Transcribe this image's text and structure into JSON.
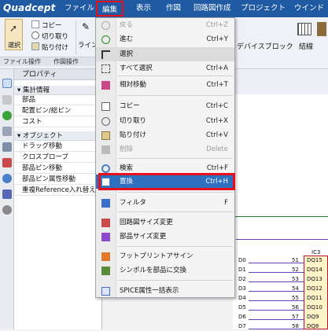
{
  "app": {
    "logo": "Quadcept"
  },
  "menubar": {
    "items": [
      "ファイル",
      "編集",
      "表示",
      "作図",
      "回路図作成",
      "プロジェクト",
      "ウインド"
    ]
  },
  "ribbon": {
    "select_label": "選択",
    "copy_label": "コピー",
    "cut_label": "切り取り",
    "paste_label": "貼り付け",
    "line_label": "ライン",
    "device_block_label": "デバイスブロック",
    "wire_label": "結線",
    "groups": [
      "ファイル操作",
      "作図操作"
    ]
  },
  "properties": {
    "title": "プロパティ",
    "categories": [
      {
        "label": "集計情報",
        "items": [
          "部品",
          "配置ピン/総ピン",
          "コスト"
        ]
      },
      {
        "label": "オブジェクト",
        "items": [
          "ドラッグ移動",
          "クロスプローブ",
          "部品ピン移動",
          "部品ピン属性移動",
          "重複Reference入れ替え"
        ]
      }
    ]
  },
  "schematic": {
    "ic_label": "IC3",
    "pins": [
      {
        "net": "D0",
        "num": "51",
        "name": "DQ15"
      },
      {
        "net": "D1",
        "num": "52",
        "name": "DQ14"
      },
      {
        "net": "D2",
        "num": "53",
        "name": "DQ13"
      },
      {
        "net": "D3",
        "num": "54",
        "name": "DQ12"
      },
      {
        "net": "D4",
        "num": "55",
        "name": "DQ11"
      },
      {
        "net": "D5",
        "num": "56",
        "name": "DQ10"
      },
      {
        "net": "D6",
        "num": "57",
        "name": "DQ9"
      },
      {
        "net": "D7",
        "num": "58",
        "name": "DQ8"
      }
    ]
  },
  "edit_menu": {
    "items": [
      {
        "label": "戻る",
        "shortcut": "Ctrl+Z",
        "icon": "undo-icon",
        "state": "disabled"
      },
      {
        "label": "進む",
        "shortcut": "Ctrl+Y",
        "icon": "redo-icon",
        "state": "normal"
      },
      {
        "label": "選択",
        "shortcut": "",
        "icon": "pointer-icon",
        "state": "selected"
      },
      {
        "label": "すべて選択",
        "shortcut": "Ctrl+A",
        "icon": "select-all-icon",
        "state": "normal"
      },
      {
        "label": "相対移動",
        "shortcut": "Ctrl+T",
        "icon": "relative-move-icon",
        "state": "normal"
      },
      {
        "label": "コピー",
        "shortcut": "Ctrl+C",
        "icon": "copy-icon",
        "state": "normal"
      },
      {
        "label": "切り取り",
        "shortcut": "Ctrl+X",
        "icon": "cut-icon",
        "state": "normal"
      },
      {
        "label": "貼り付け",
        "shortcut": "Ctrl+V",
        "icon": "paste-icon",
        "state": "normal"
      },
      {
        "label": "削除",
        "shortcut": "Delete",
        "icon": "delete-icon",
        "state": "disabled"
      },
      {
        "label": "検索",
        "shortcut": "Ctrl+F",
        "icon": "search-icon",
        "state": "normal"
      },
      {
        "label": "置換",
        "shortcut": "Ctrl+H",
        "icon": "replace-icon",
        "state": "highlighted"
      },
      {
        "label": "フィルタ",
        "shortcut": "F",
        "icon": "filter-icon",
        "state": "normal"
      },
      {
        "label": "回路図サイズ変更",
        "shortcut": "",
        "icon": "schematic-size-icon",
        "state": "normal"
      },
      {
        "label": "部品サイズ変更",
        "shortcut": "",
        "icon": "part-size-icon",
        "state": "normal"
      },
      {
        "label": "フットプリントアサイン",
        "shortcut": "",
        "icon": "footprint-icon",
        "state": "normal"
      },
      {
        "label": "シンボルを部品に交換",
        "shortcut": "",
        "icon": "symbol-swap-icon",
        "state": "normal"
      },
      {
        "label": "SPICE属性一括表示",
        "shortcut": "",
        "icon": "spice-icon",
        "state": "normal"
      }
    ]
  },
  "colors": {
    "menubar": "#1f5aa3",
    "highlight": "#2f6fbf",
    "annotation": "#e8101a"
  }
}
